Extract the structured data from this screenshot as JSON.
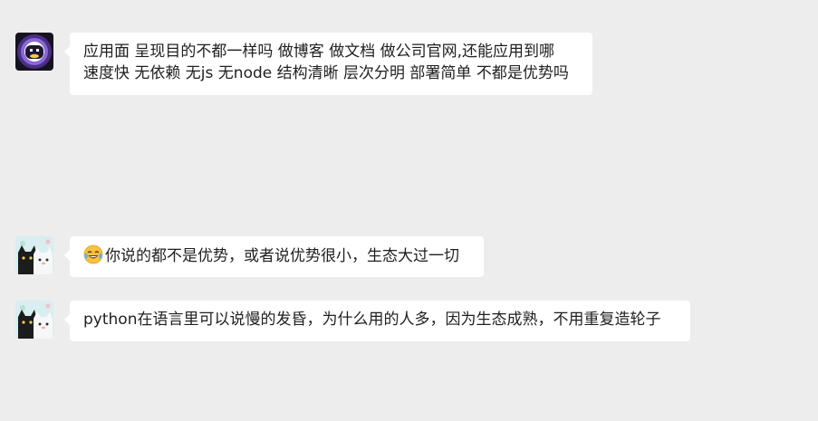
{
  "messages": [
    {
      "sender": "bot",
      "lines": [
        "应用面 呈现目的不都一样吗 做博客 做文档 做公司官网,还能应用到哪",
        "速度快 无依赖 无js 无node 结构清晰 层次分明 部署简单 不都是优势吗"
      ]
    },
    {
      "sender": "cat-user",
      "emoji": "tears-of-joy-emoji",
      "text": "你说的都不是优势，或者说优势很小，生态大过一切"
    },
    {
      "sender": "cat-user",
      "text": "python在语言里可以说慢的发昏，为什么用的人多，因为生态成熟，不用重复造轮子"
    }
  ],
  "colors": {
    "background": "#ededed",
    "bubble": "#ffffff",
    "text": "#1f1f1f"
  }
}
